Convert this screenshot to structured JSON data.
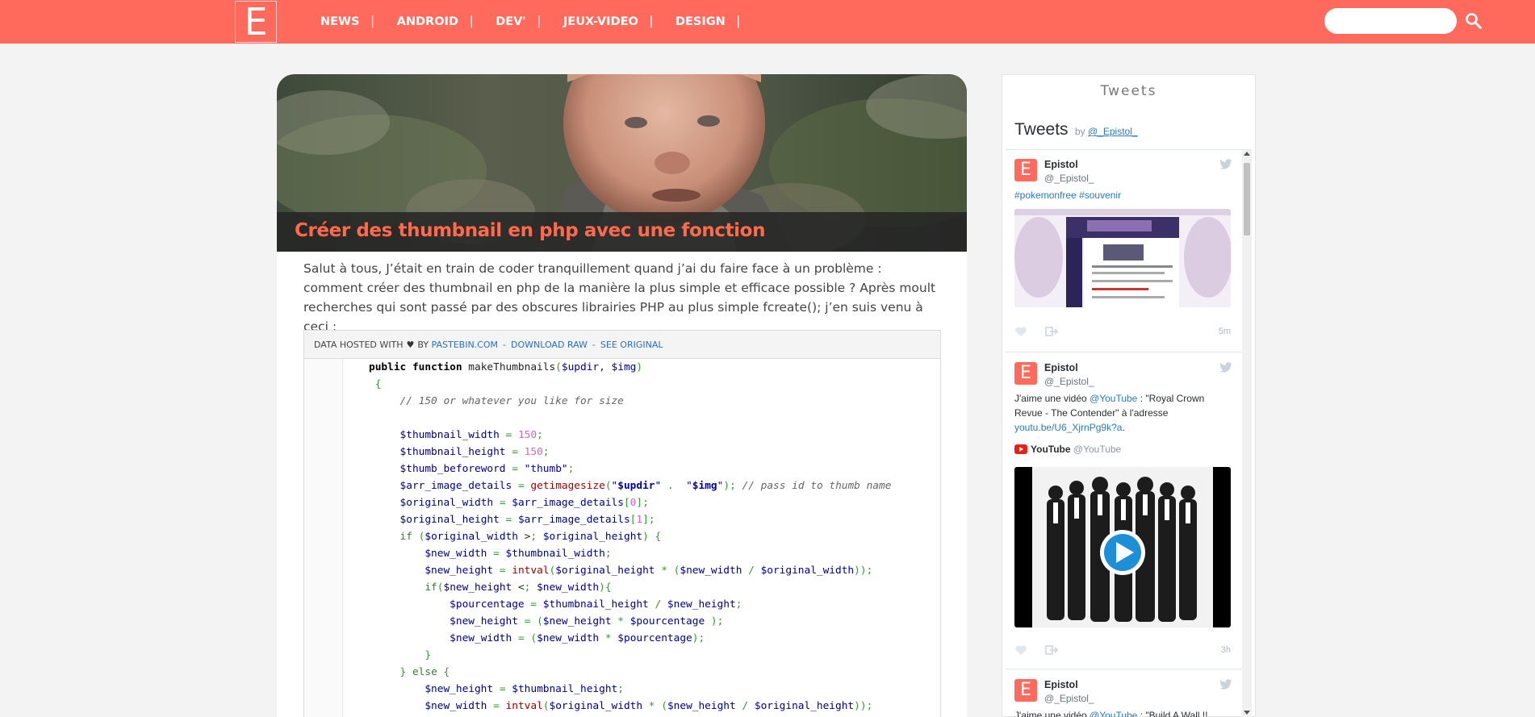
{
  "site": {
    "logo": "E",
    "search": {
      "placeholder": ""
    }
  },
  "nav": [
    {
      "label": "News",
      "sep": "|"
    },
    {
      "label": "Android",
      "sep": "|"
    },
    {
      "label": "Dev'",
      "sep": "|"
    },
    {
      "label": "Jeux-Video",
      "sep": "|"
    },
    {
      "label": "Design",
      "sep": "|"
    }
  ],
  "article": {
    "title": "Créer des thumbnail en php avec une fonction",
    "intro": "Salut à tous, J’était en train de coder tranquillement quand j’ai du faire face à un problème : comment créer des thumbnail en php de la manière la plus simple et efficace possible ? Après moult recherches qui sont passé par des obscures librairies PHP au plus simple fcreate(); j’en suis venu à ceci :"
  },
  "paste": {
    "hosted_by": "Data hosted with",
    "heart": "♥",
    "by": "by",
    "pastebin": "Pastebin.com",
    "sep": "-",
    "download_raw": "Download Raw",
    "see_original": "See Original",
    "code": [
      "public function makeThumbnails($updir, $img)",
      " {",
      "     // 150 or whatever you like for size",
      "",
      "     $thumbnail_width = 150;",
      "     $thumbnail_height = 150;",
      "     $thumb_beforeword = \"thumb\";",
      "     $arr_image_details = getimagesize(\"$updir\" .  \"$img\"); // pass id to thumb name",
      "     $original_width = $arr_image_details[0];",
      "     $original_height = $arr_image_details[1];",
      "     if ($original_width > $original_height) {",
      "         $new_width = $thumbnail_width;",
      "         $new_height = intval($original_height * ($new_width / $original_width));",
      "         if($new_height < $new_width){",
      "             $pourcentage = $thumbnail_height / $new_height;",
      "             $new_height = ($new_height * $pourcentage );",
      "             $new_width = ($new_width * $pourcentage);",
      "         }",
      "     } else {",
      "         $new_height = $thumbnail_height;",
      "         $new_width = intval($original_width * ($new_height / $original_height));"
    ]
  },
  "sidebar": {
    "heading": "Tweets",
    "timeline_title": "Tweets",
    "timeline_by": "by",
    "timeline_handle": "@_Epistol_"
  },
  "tweets": [
    {
      "avatar": "E",
      "name": "Epistol",
      "handle": "@_Epistol_",
      "text_link1": "#pokemonfree",
      "text_link2": "#souvenir",
      "time": "5m"
    },
    {
      "avatar": "E",
      "name": "Epistol",
      "handle": "@_Epistol_",
      "text_part1": "J'aime une vidéo ",
      "text_mention": "@YouTube",
      "text_part2": " : \"Royal Crown Revue - The Contender\" à l'adresse ",
      "text_url": "youtu.be/U6_XjrnPg9k?a",
      "text_end": ".",
      "card_name": "YouTube",
      "card_handle": "@YouTube",
      "time": "3h"
    },
    {
      "avatar": "E",
      "name": "Epistol",
      "handle": "@_Epistol_",
      "text_part1": "J'aime une vidéo ",
      "text_mention": "@YouTube",
      "text_part2": " : \"Build A Wall !!"
    }
  ],
  "colors": {
    "brand": "#ff6a5c",
    "title": "#ff6a4d",
    "link": "#2b7bb9"
  }
}
